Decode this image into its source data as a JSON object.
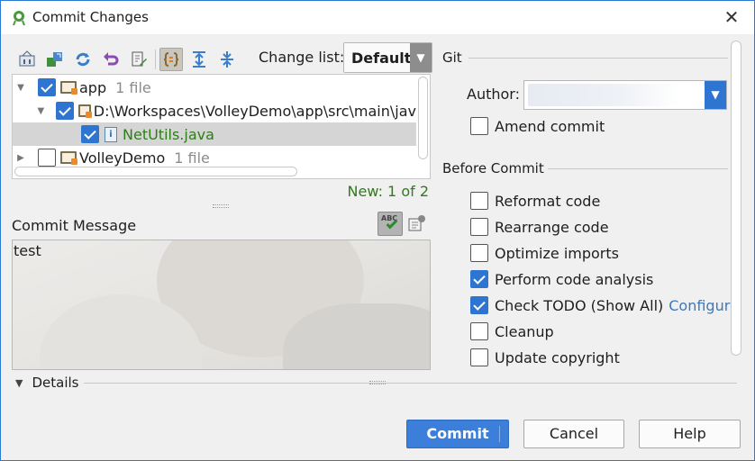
{
  "window": {
    "title": "Commit Changes"
  },
  "toolbar": {
    "icons": [
      "show-diff-icon",
      "move-to-changelist-icon",
      "refresh-icon",
      "rollback-icon",
      "edit-source-icon",
      "group-by-directory-icon",
      "expand-all-icon",
      "collapse-all-icon"
    ],
    "changelist_label": "Change list:",
    "changelist_value": "Default"
  },
  "tree": {
    "rows": [
      {
        "label": "app",
        "count": "1 file",
        "checked": true
      },
      {
        "label": "D:\\Workspaces\\VolleyDemo\\app\\src\\main\\jav",
        "count": "",
        "checked": true
      },
      {
        "label": "NetUtils.java",
        "count": "",
        "checked": true
      },
      {
        "label": "VolleyDemo",
        "count": "1 file",
        "checked": false
      }
    ],
    "new_count": "New: 1 of 2"
  },
  "commit_message": {
    "label": "Commit Message",
    "value": "test"
  },
  "details": {
    "label": "Details"
  },
  "git": {
    "section_title": "Git",
    "author_label": "Author:",
    "author_value": "",
    "amend_label": "Amend commit",
    "amend_checked": false
  },
  "before_commit": {
    "section_title": "Before Commit",
    "options": [
      {
        "label": "Reformat code",
        "checked": false
      },
      {
        "label": "Rearrange code",
        "checked": false
      },
      {
        "label": "Optimize imports",
        "checked": false
      },
      {
        "label": "Perform code analysis",
        "checked": true
      },
      {
        "label": "Check TODO (Show All)",
        "checked": true,
        "link": "Configure"
      },
      {
        "label": "Cleanup",
        "checked": false
      },
      {
        "label": "Update copyright",
        "checked": false
      }
    ]
  },
  "buttons": {
    "commit": "Commit",
    "cancel": "Cancel",
    "help": "Help"
  },
  "colors": {
    "accent": "#2e75d1",
    "new_text": "#2d7d19",
    "link": "#3e78bd"
  }
}
